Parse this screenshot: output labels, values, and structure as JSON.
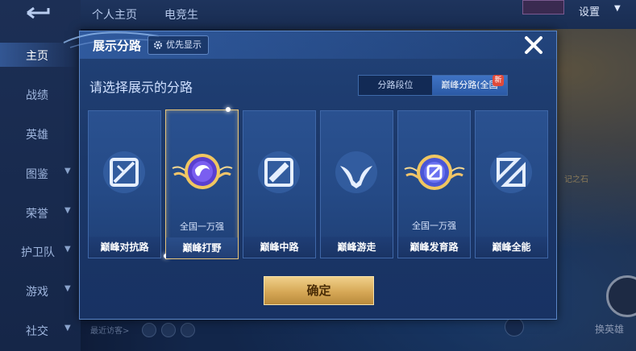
{
  "sidebar": {
    "items": [
      {
        "label": "主页",
        "active": true,
        "chevron": false
      },
      {
        "label": "战绩",
        "active": false,
        "chevron": false
      },
      {
        "label": "英雄",
        "active": false,
        "chevron": false
      },
      {
        "label": "图鉴",
        "active": false,
        "chevron": true
      },
      {
        "label": "荣誉",
        "active": false,
        "chevron": true
      },
      {
        "label": "护卫队",
        "active": false,
        "chevron": true
      },
      {
        "label": "游戏",
        "active": false,
        "chevron": true
      },
      {
        "label": "社交",
        "active": false,
        "chevron": true
      }
    ]
  },
  "topbar": {
    "tabs": [
      "个人主页",
      "电竞生"
    ],
    "settings_label": "设置"
  },
  "background": {
    "visitor_label": "最近访客>",
    "swap_label": "换英雄",
    "map_text": "记之石"
  },
  "dialog": {
    "title": "展示分路",
    "priority_button": "优先显示",
    "close_icon": "close-icon",
    "prompt": "请选择展示的分路",
    "tabs": [
      {
        "label": "分路段位",
        "selected": false
      },
      {
        "label": "巅峰分路(全国",
        "selected": true
      }
    ],
    "new_badge": "新",
    "cards": [
      {
        "label": "巅峰对抗路",
        "sub": "",
        "icon": "clash-lane-icon",
        "selected": false
      },
      {
        "label": "巅峰打野",
        "sub": "全国一万强",
        "icon": "jungle-medal-icon",
        "selected": true
      },
      {
        "label": "巅峰中路",
        "sub": "",
        "icon": "mid-lane-icon",
        "selected": false
      },
      {
        "label": "巅峰游走",
        "sub": "",
        "icon": "roam-icon",
        "selected": false
      },
      {
        "label": "巅峰发育路",
        "sub": "全国一万强",
        "icon": "farm-lane-medal-icon",
        "selected": false
      },
      {
        "label": "巅峰全能",
        "sub": "",
        "icon": "all-round-icon",
        "selected": false
      }
    ],
    "confirm_label": "确定"
  },
  "colors": {
    "accent_gold": "#e6c47a",
    "panel_blue": "#214278",
    "selected_tab": "#3f73c4",
    "badge_red": "#e04a3a"
  }
}
